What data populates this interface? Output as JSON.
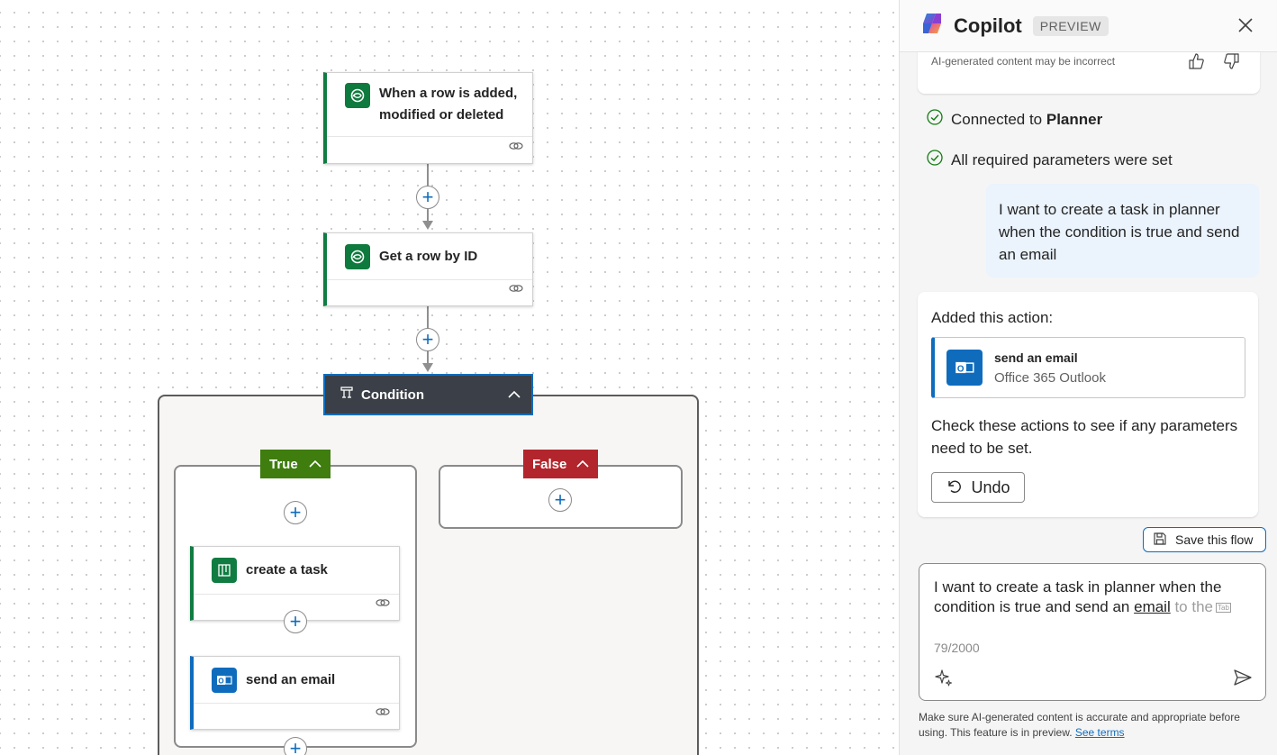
{
  "flow": {
    "trigger": {
      "title_line1": "When a row is added,",
      "title_line2": "modified or deleted",
      "icon": "dataverse-icon"
    },
    "get_row": {
      "title": "Get a row by ID",
      "icon": "dataverse-icon"
    },
    "condition": {
      "title": "Condition",
      "icon": "condition-icon"
    },
    "true_branch": {
      "label": "True"
    },
    "false_branch": {
      "label": "False"
    },
    "create_task": {
      "title": "create a task",
      "icon": "planner-icon"
    },
    "send_email": {
      "title": "send an email",
      "icon": "outlook-icon"
    },
    "colors": {
      "dataverse": "#0e7a3d",
      "true": "#3e7d0e",
      "false": "#b3252c",
      "condition": "#3b3f47",
      "accent": "#0f6cbd"
    }
  },
  "copilot": {
    "title": "Copilot",
    "badge": "PREVIEW",
    "ai_note": "AI-generated content may be incorrect",
    "status": [
      {
        "prefix": "Connected to ",
        "bold": "Planner"
      },
      {
        "prefix": "All required parameters were set",
        "bold": ""
      }
    ],
    "user_message": "I want to create a task in planner when the condition is true and send an email",
    "response": {
      "added_label": "Added this action:",
      "action_name": "send an email",
      "action_connector": "Office 365 Outlook",
      "check_text": "Check these actions to see if any parameters need to be set.",
      "undo_label": "Undo"
    },
    "save_flow_label": "Save this flow",
    "input": {
      "text_before": "I want to create a task in planner when the condition is true and send an ",
      "text_email": "email",
      "ghost_text": " to the",
      "tab_hint": "Tab",
      "counter": "79/2000"
    },
    "disclaimer": "Make sure AI-generated content is accurate and appropriate before using. This feature is in preview.",
    "terms_link": "See terms"
  }
}
